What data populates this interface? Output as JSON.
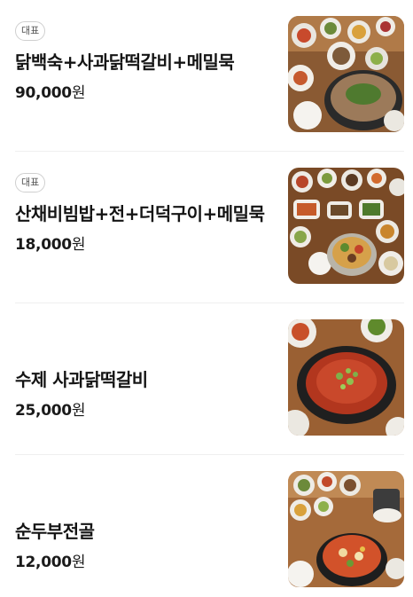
{
  "menu": {
    "items": [
      {
        "badge": "대표",
        "name": "닭백숙+사과닭떡갈비+메밀묵",
        "price": "90,000",
        "currency": "원",
        "photo": "samgyetang-table-photo"
      },
      {
        "badge": "대표",
        "name": "산채비빔밥+전+더덕구이+메밀묵",
        "price": "18,000",
        "currency": "원",
        "photo": "bibimbap-set-photo"
      },
      {
        "name": "수제 사과닭떡갈비",
        "price": "25,000",
        "currency": "원",
        "photo": "tteokgalbi-photo"
      },
      {
        "name": "순두부전골",
        "price": "12,000",
        "currency": "원",
        "photo": "sundubu-jeongol-photo"
      }
    ]
  }
}
